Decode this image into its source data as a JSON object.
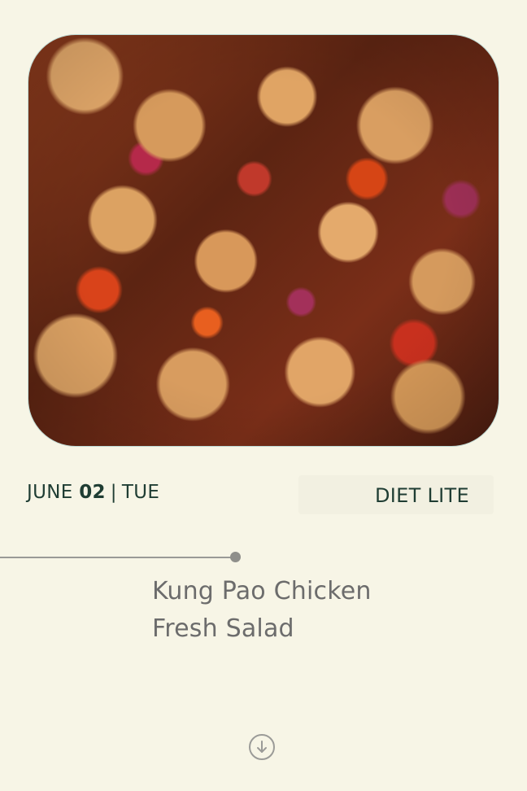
{
  "header": {
    "month": "JUNE",
    "day": "02",
    "separator": "|",
    "weekday": "TUE",
    "diet_label": "DIET LITE"
  },
  "image": {
    "icon": "food-photo"
  },
  "menu": {
    "items": [
      {
        "label": "Kung Pao Chicken"
      },
      {
        "label": "Fresh Salad"
      }
    ]
  },
  "scroll_button": {
    "icon": "arrow-down-circle-icon"
  },
  "colors": {
    "background": "#f7f5e6",
    "text_dark": "#1f3d33",
    "text_muted": "#6c6c6c",
    "accent_border": "#bcd9d4"
  }
}
